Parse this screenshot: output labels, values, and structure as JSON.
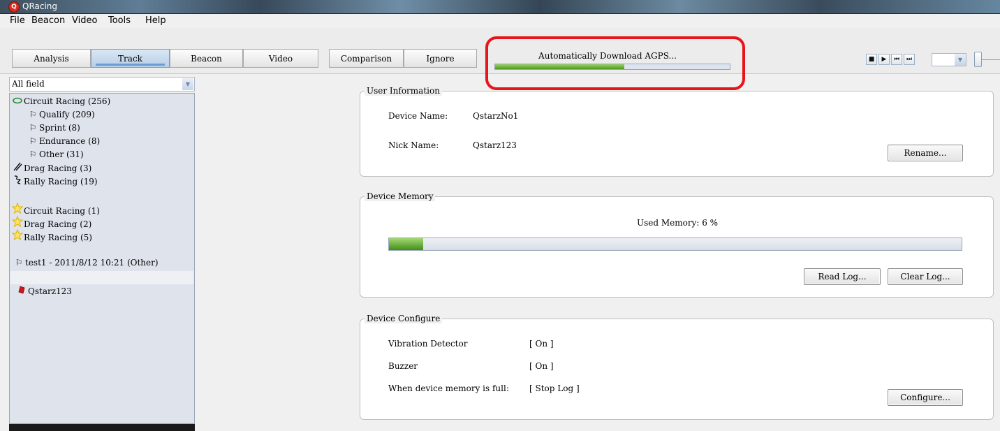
{
  "window": {
    "title": "QRacing"
  },
  "menu": [
    "File",
    "Beacon",
    "Video",
    "Tools",
    "Help"
  ],
  "tabs": [
    {
      "label": "Analysis"
    },
    {
      "label": "Track",
      "active": true
    },
    {
      "label": "Beacon"
    },
    {
      "label": "Video"
    },
    {
      "label": "Comparison"
    },
    {
      "label": "Ignore"
    }
  ],
  "agps": {
    "text": "Automatically Download AGPS...",
    "progress": 0.55
  },
  "filter": {
    "selected": "All field"
  },
  "tree": [
    {
      "icon": "circuit-icon",
      "label": "Circuit Racing (256)"
    },
    {
      "icon": "flag-icon",
      "label": "Qualify (209)"
    },
    {
      "icon": "flag-icon",
      "label": "Sprint (8)"
    },
    {
      "icon": "flag-icon",
      "label": "Endurance (8)"
    },
    {
      "icon": "flag-icon",
      "label": "Other (31)"
    },
    {
      "icon": "drag-icon",
      "label": "Drag Racing (3)"
    },
    {
      "icon": "rally-icon",
      "label": "Rally Racing (19)"
    },
    {
      "icon": "star-icon",
      "label": "Circuit Racing (1)"
    },
    {
      "icon": "star-icon",
      "label": "Drag Racing (2)"
    },
    {
      "icon": "star-icon",
      "label": "Rally Racing (5)"
    },
    {
      "icon": "flag-icon",
      "label": "test1 - 2011/8/12 10:21 (Other)"
    },
    {
      "icon": "device-icon",
      "label": "Qstarz123"
    }
  ],
  "user_info": {
    "legend": "User Information",
    "device_name_label": "Device Name:",
    "device_name": "QstarzNo1",
    "nick_name_label": "Nick Name:",
    "nick_name": "Qstarz123",
    "rename_button": "Rename..."
  },
  "memory": {
    "legend": "Device Memory",
    "used_text": "Used Memory: 6 %",
    "used_percent": 6,
    "read_button": "Read Log...",
    "clear_button": "Clear Log..."
  },
  "configure": {
    "legend": "Device Configure",
    "rows": [
      {
        "label": "Vibration Detector",
        "value": "[ On ]"
      },
      {
        "label": "Buzzer",
        "value": "[ On ]"
      },
      {
        "label": "When device memory is full:",
        "value": "[ Stop Log ]"
      }
    ],
    "configure_button": "Configure..."
  }
}
